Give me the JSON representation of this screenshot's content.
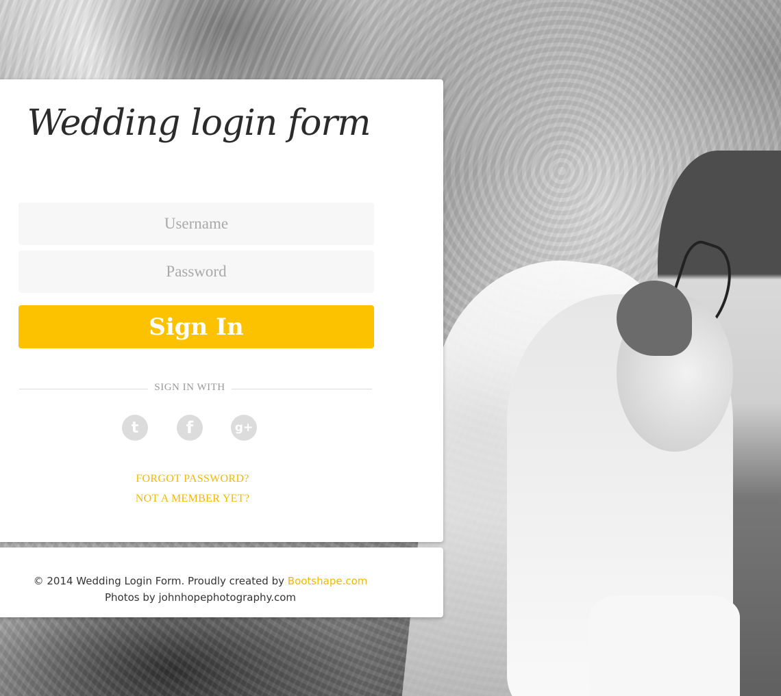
{
  "form": {
    "title": "Wedding login form",
    "username_placeholder": "Username",
    "password_placeholder": "Password",
    "signin_label": "Sign In",
    "divider_label": "SIGN IN WITH",
    "social": [
      {
        "name": "twitter",
        "icon": "twitter-icon",
        "glyph": "t"
      },
      {
        "name": "facebook",
        "icon": "facebook-icon",
        "glyph": "f"
      },
      {
        "name": "google-plus",
        "icon": "google-plus-icon",
        "glyph": "g+"
      }
    ],
    "forgot_password": "FORGOT PASSWORD?",
    "not_member": "NOT A MEMBER YET?"
  },
  "footer": {
    "copyright": "© 2014 Wedding Login Form. Proudly created by",
    "brand_link": "Bootshape.com",
    "photos_credit": "Photos by johnhopephotography.com"
  },
  "colors": {
    "accent": "#fcc200",
    "link": "#f5b800",
    "field_bg": "#f7f7f7",
    "social_icon_bg": "#dcdcdc"
  }
}
